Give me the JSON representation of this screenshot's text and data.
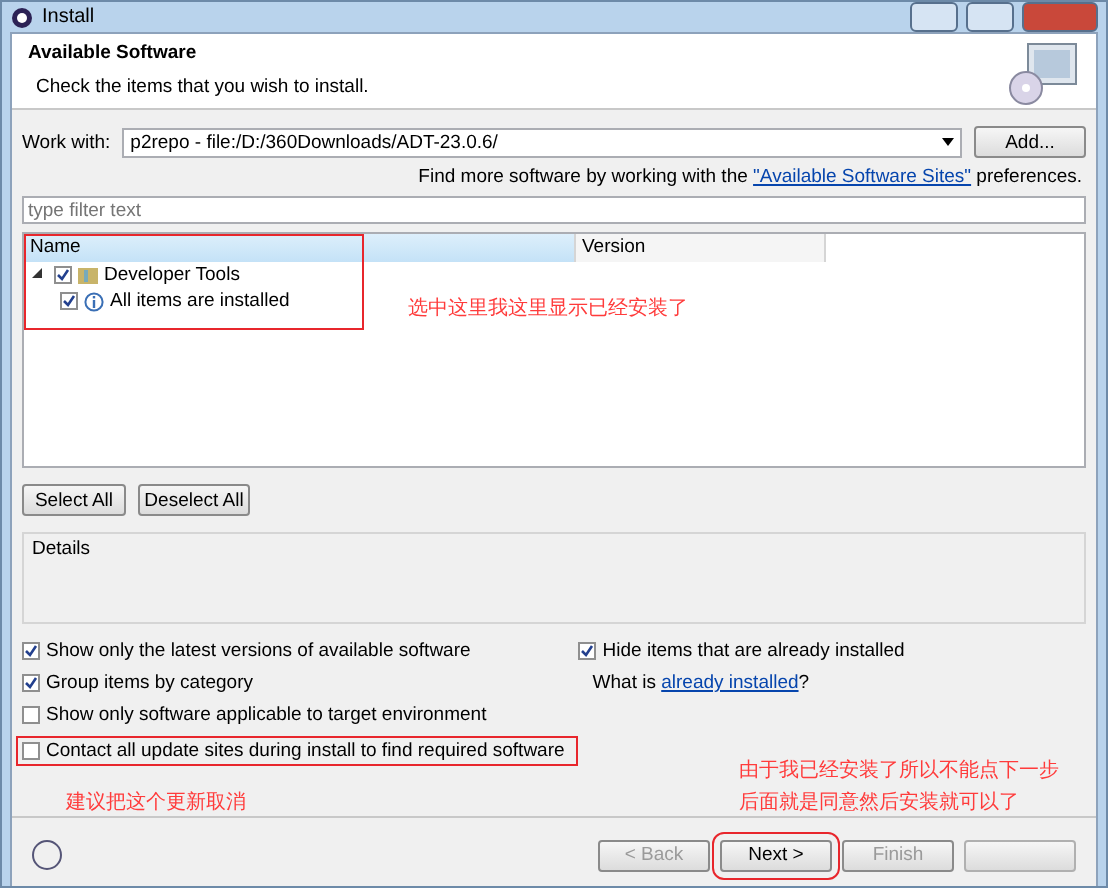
{
  "window": {
    "title": "Install"
  },
  "header": {
    "title": "Available Software",
    "subtitle": "Check the items that you wish to install."
  },
  "work_with": {
    "label": "Work with:",
    "value": "p2repo - file:/D:/360Downloads/ADT-23.0.6/",
    "add_button": "Add..."
  },
  "sites_line": {
    "before": "Find more software by working with the ",
    "link": "\"Available Software Sites\"",
    "after": " preferences."
  },
  "filter": {
    "placeholder": "type filter text"
  },
  "table": {
    "columns": [
      "Name",
      "Version"
    ],
    "rows": [
      {
        "label": "Developer Tools",
        "checked": true,
        "expanded": true,
        "children": [
          {
            "label": "All items are installed",
            "checked": true
          }
        ]
      }
    ]
  },
  "table_buttons": [
    "Select All",
    "Deselect All"
  ],
  "details": {
    "label": "Details"
  },
  "options_left": [
    {
      "label": "Show only the latest versions of available software",
      "checked": true
    },
    {
      "label": "Group items by category",
      "checked": true
    },
    {
      "label": "Show only software applicable to target environment",
      "checked": false
    },
    {
      "label": "Contact all update sites during install to find required software",
      "checked": false
    }
  ],
  "options_right": [
    {
      "label": "Hide items that are already installed",
      "checked": true
    }
  ],
  "installed_line": {
    "before": "What is ",
    "link": "already installed",
    "after": "?"
  },
  "annotations": [
    "选中这里我这里显示已经安装了",
    "建议把这个更新取消",
    "由于我已经安装了所以不能点下一步",
    "后面就是同意然后安装就可以了"
  ],
  "footer_buttons": [
    {
      "label": "< Back",
      "disabled": true
    },
    {
      "label": "Next >",
      "disabled": false
    },
    {
      "label": "Finish",
      "disabled": true
    }
  ]
}
